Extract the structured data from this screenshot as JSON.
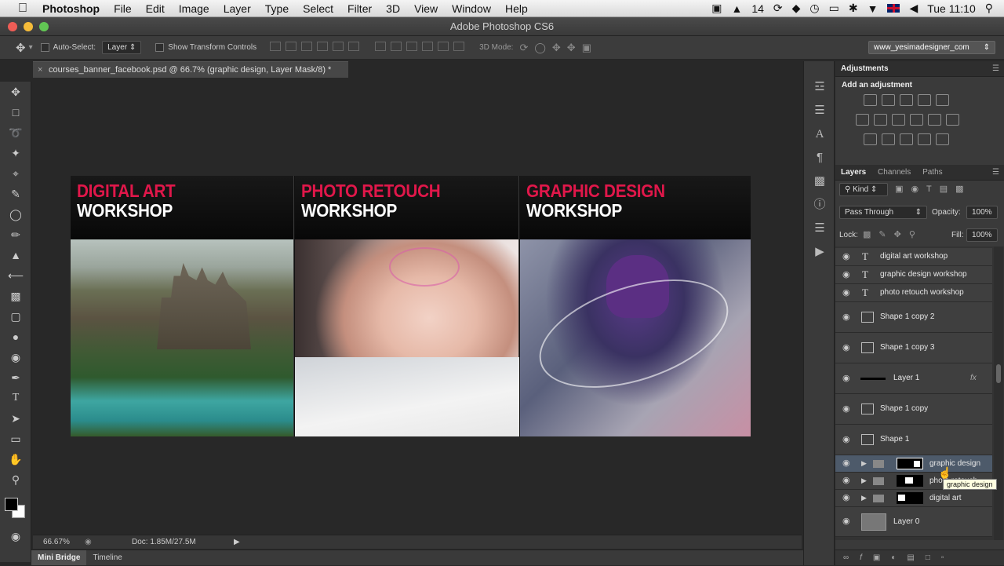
{
  "menubar": {
    "apple": "",
    "app": "Photoshop",
    "items": [
      "File",
      "Edit",
      "Image",
      "Layer",
      "Type",
      "Select",
      "Filter",
      "3D",
      "View",
      "Window",
      "Help"
    ],
    "status_num": "14",
    "clock": "Tue 11:10"
  },
  "window": {
    "title": "Adobe Photoshop CS6"
  },
  "options": {
    "auto_select_label": "Auto-Select:",
    "auto_select_value": "Layer",
    "transform_label": "Show Transform Controls",
    "mode3d_label": "3D Mode:",
    "workspace": "www_yesimadesigner_com"
  },
  "document": {
    "tab": "courses_banner_facebook.psd @ 66.7% (graphic design, Layer Mask/8) *",
    "zoom": "66.67%",
    "docsize": "Doc: 1.85M/27.5M"
  },
  "banner": {
    "columns": [
      {
        "line1": "DIGITAL ART",
        "line2": "WORKSHOP"
      },
      {
        "line1": "PHOTO RETOUCH",
        "line2": "WORKSHOP"
      },
      {
        "line1": "GRAPHIC DESIGN",
        "line2": "WORKSHOP"
      }
    ],
    "accent": "#e0174a"
  },
  "bottom_tabs": [
    "Mini Bridge",
    "Timeline"
  ],
  "adjustments": {
    "title": "Adjustments",
    "subtitle": "Add an adjustment"
  },
  "layers_panel": {
    "tabs": [
      "Layers",
      "Channels",
      "Paths"
    ],
    "kind": "Kind",
    "blend": "Pass Through",
    "opacity_label": "Opacity:",
    "opacity": "100%",
    "lock_label": "Lock:",
    "fill_label": "Fill:",
    "fill": "100%",
    "layers": [
      {
        "name": "digital art workshop",
        "type": "text"
      },
      {
        "name": "graphic design workshop",
        "type": "text"
      },
      {
        "name": "photo retouch workshop",
        "type": "text"
      },
      {
        "name": "Shape 1 copy 2",
        "type": "shape"
      },
      {
        "name": "Shape 1 copy 3",
        "type": "shape"
      },
      {
        "name": "Layer 1",
        "type": "pixel",
        "fx": "fx"
      },
      {
        "name": "Shape 1 copy",
        "type": "shape"
      },
      {
        "name": "Shape 1",
        "type": "shape"
      },
      {
        "name": "graphic design",
        "type": "group"
      },
      {
        "name": "photo retouch",
        "type": "group"
      },
      {
        "name": "digital art",
        "type": "group"
      },
      {
        "name": "Layer 0",
        "type": "pixel"
      }
    ],
    "tooltip": "graphic design"
  }
}
